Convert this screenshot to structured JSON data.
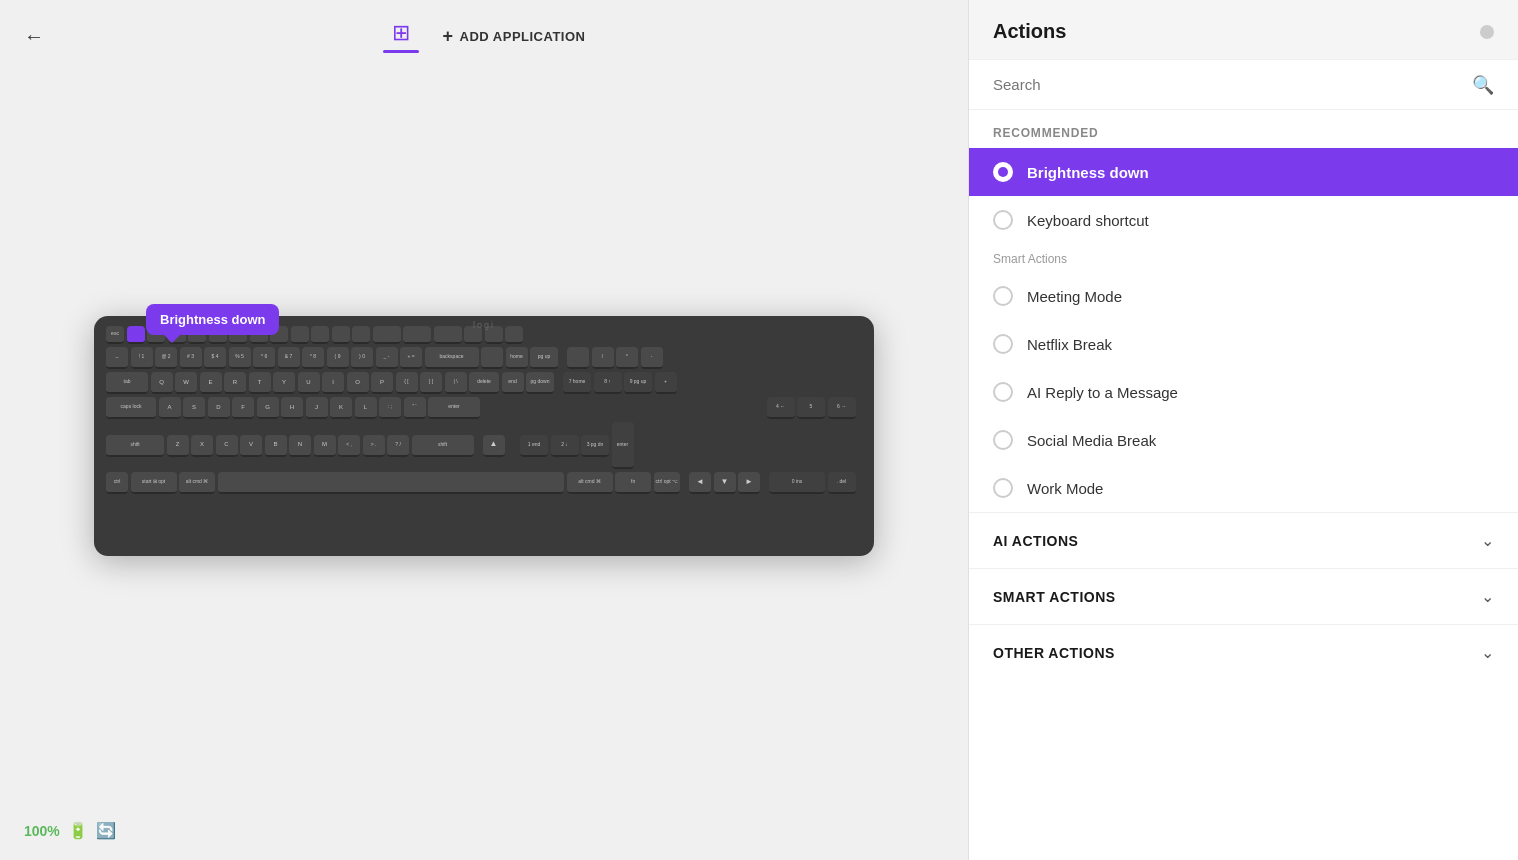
{
  "app": {
    "title": "Actions"
  },
  "topbar": {
    "back_label": "←",
    "add_app_label": "ADD APPLICATION"
  },
  "keyboard": {
    "tooltip": "Brightness down",
    "highlighted_key": "F2-area"
  },
  "status": {
    "battery_pct": "100%"
  },
  "panel": {
    "title": "Actions",
    "search_placeholder": "Search"
  },
  "sections": {
    "recommended_label": "RECOMMENDED",
    "smart_actions_label": "Smart Actions",
    "ai_actions_label": "AI ACTIONS",
    "smart_actions_section_label": "SMART ACTIONS",
    "other_actions_label": "OTHER ACTIONS"
  },
  "recommended_items": [
    {
      "id": "brightness-down",
      "label": "Brightness down",
      "selected": true
    },
    {
      "id": "keyboard-shortcut",
      "label": "Keyboard shortcut",
      "selected": false
    }
  ],
  "smart_action_items": [
    {
      "id": "meeting-mode",
      "label": "Meeting Mode",
      "selected": false
    },
    {
      "id": "netflix-break",
      "label": "Netflix Break",
      "selected": false
    },
    {
      "id": "ai-reply",
      "label": "AI Reply to a Message",
      "selected": false
    },
    {
      "id": "social-media-break",
      "label": "Social Media Break",
      "selected": false
    },
    {
      "id": "work-mode",
      "label": "Work Mode",
      "selected": false
    }
  ],
  "collapsible_sections": [
    {
      "id": "ai-actions",
      "label": "AI ACTIONS"
    },
    {
      "id": "smart-actions",
      "label": "SMART ACTIONS"
    },
    {
      "id": "other-actions",
      "label": "OTHER ACTIONS"
    }
  ],
  "icons": {
    "back": "←",
    "plus": "+",
    "grid": "⊞",
    "search": "🔍",
    "battery": "🔋",
    "sync": "🔄",
    "chevron_down": "⌄",
    "minimize": "—"
  }
}
